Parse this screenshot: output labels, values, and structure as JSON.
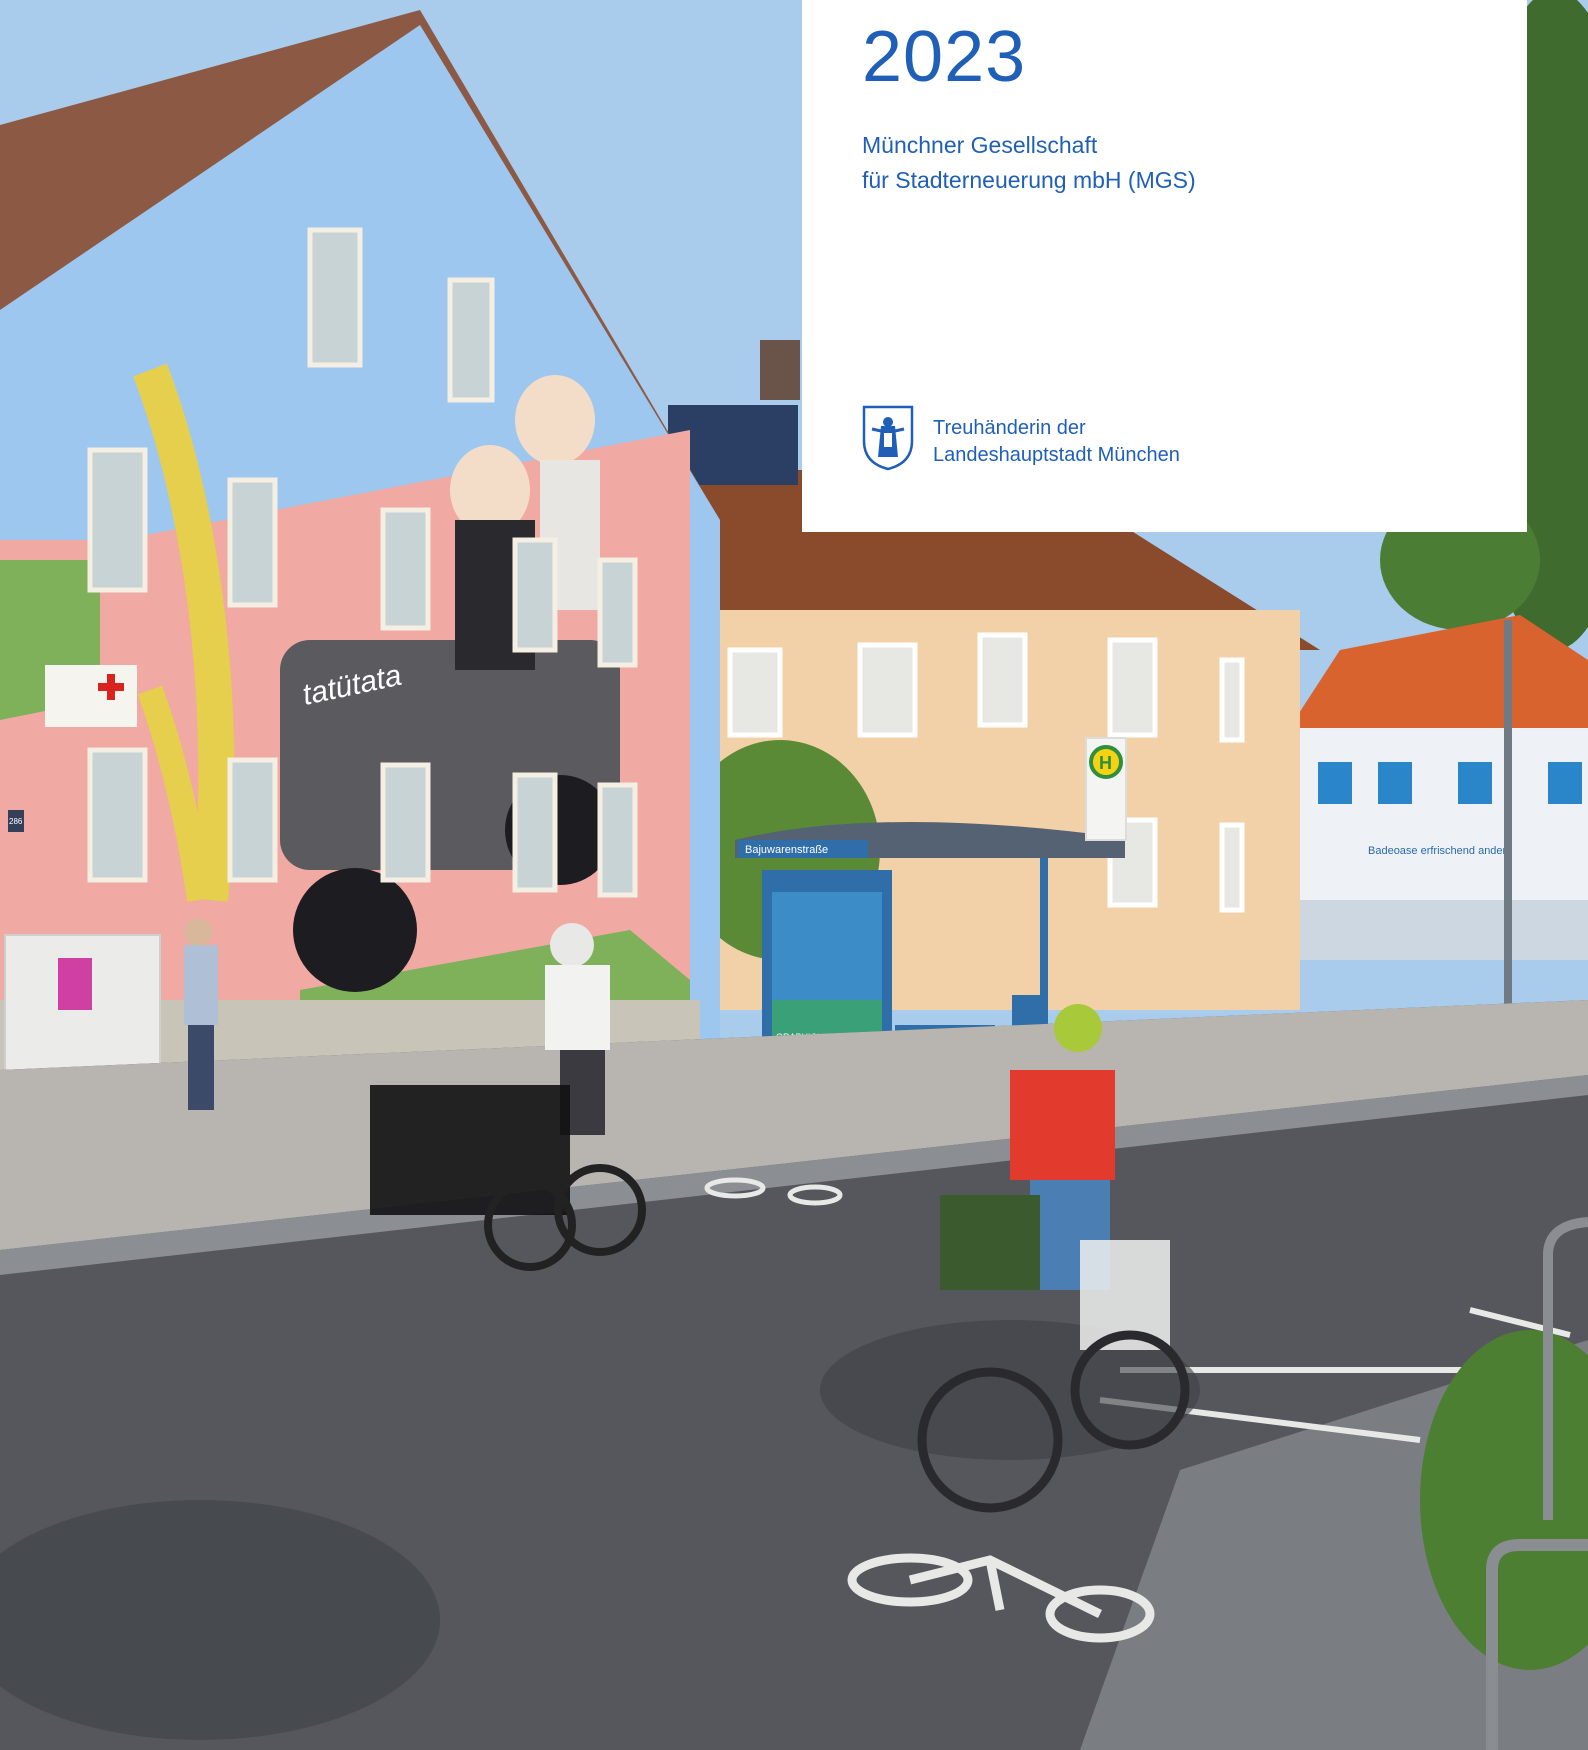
{
  "cover": {
    "year": "2023",
    "organization_line1": "Münchner Gesellschaft",
    "organization_line2": "für Stadterneuerung mbH (MGS)",
    "trustee_line1": "Treuhänderin der",
    "trustee_line2": "Landeshauptstadt München"
  },
  "photo": {
    "mural_text": "tatütata",
    "bus_stop_sign": "Bajuwarenstraße",
    "house_number": "286",
    "shop_sign": "Badeoase erfrischend anders",
    "poster_text": "GRAPHIQUE HODERS",
    "bus_stop_symbol": "H"
  },
  "colors": {
    "brand_blue": "#1f5fb8",
    "panel_bg": "#ffffff"
  }
}
